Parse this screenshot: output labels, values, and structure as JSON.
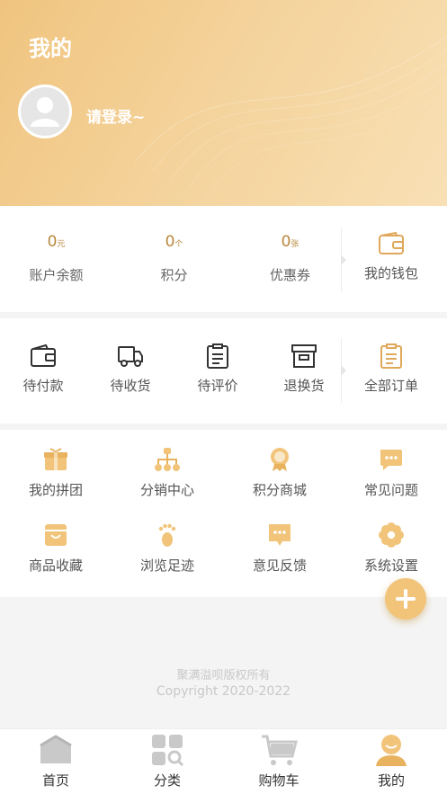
{
  "header": {
    "title": "我的",
    "login_prompt": "请登录~"
  },
  "assets": {
    "items": [
      {
        "value": "0",
        "unit": "元",
        "label": "账户余额"
      },
      {
        "value": "0",
        "unit": "个",
        "label": "积分"
      },
      {
        "value": "0",
        "unit": "张",
        "label": "优惠券"
      }
    ],
    "wallet_label": "我的钱包"
  },
  "orders": {
    "items": [
      {
        "label": "待付款",
        "icon": "wallet-icon"
      },
      {
        "label": "待收货",
        "icon": "truck-icon"
      },
      {
        "label": "待评价",
        "icon": "clipboard-icon"
      },
      {
        "label": "退换货",
        "icon": "box-icon"
      }
    ],
    "all_label": "全部订单"
  },
  "services": {
    "items": [
      {
        "label": "我的拼团",
        "icon": "gift-icon"
      },
      {
        "label": "分销中心",
        "icon": "org-chart-icon"
      },
      {
        "label": "积分商城",
        "icon": "medal-icon"
      },
      {
        "label": "常见问题",
        "icon": "chat-icon"
      },
      {
        "label": "商品收藏",
        "icon": "favorites-box-icon"
      },
      {
        "label": "浏览足迹",
        "icon": "footprint-icon"
      },
      {
        "label": "意见反馈",
        "icon": "feedback-icon"
      },
      {
        "label": "系统设置",
        "icon": "flower-settings-icon"
      }
    ]
  },
  "footer": {
    "copyright_owner": "聚满溢呗版权所有",
    "copyright": "Copyright 2020-2022"
  },
  "tabbar": {
    "items": [
      {
        "label": "首页",
        "icon": "home-icon"
      },
      {
        "label": "分类",
        "icon": "category-icon"
      },
      {
        "label": "购物车",
        "icon": "cart-icon"
      },
      {
        "label": "我的",
        "icon": "user-icon",
        "active": true
      }
    ]
  },
  "colors": {
    "accent": "#f1c47a",
    "accent_text": "#b8873b",
    "gray_icon": "#c9c9c9"
  }
}
